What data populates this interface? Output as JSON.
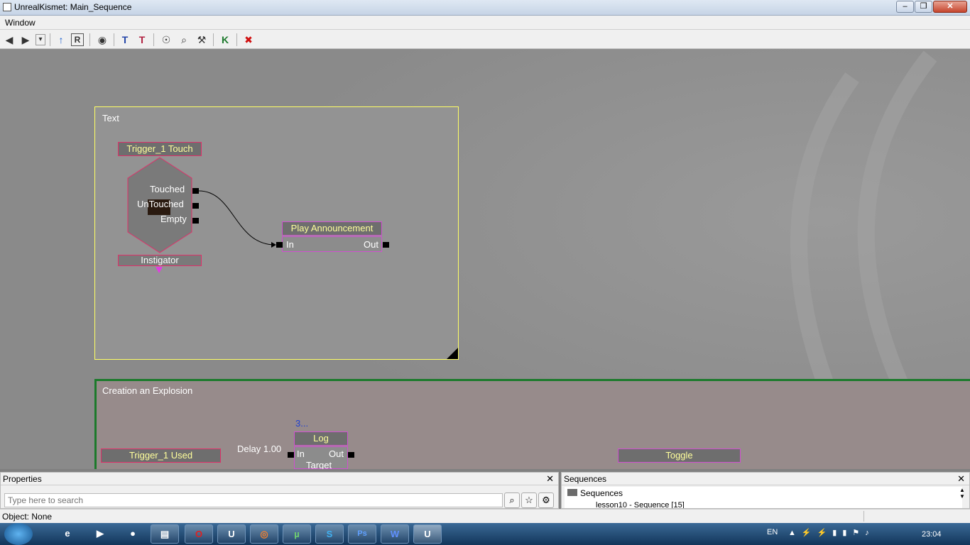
{
  "window": {
    "title": "UnrealKismet: Main_Sequence",
    "minimize": "–",
    "maximize": "❒",
    "close": "✕"
  },
  "menu": {
    "items": [
      "Window"
    ]
  },
  "toolbar": {
    "icons": [
      "back-arrow-icon",
      "forward-arrow-icon",
      "history-dropdown-icon",
      "parent-sequence-icon",
      "rename-icon",
      "hide-unused-icon",
      "zoom-to-fit-icon",
      "zoom-to-selection-icon",
      "light-bulb-icon",
      "search-icon",
      "wrench-icon",
      "kismet-icon",
      "stop-icon"
    ],
    "glyphs": [
      "◀",
      "▶",
      "▾",
      "↑",
      "R",
      "◉",
      "T",
      "T",
      "☉",
      "⌕",
      "⚒",
      "K",
      "✖"
    ]
  },
  "canvas": {
    "comment_text": {
      "title": "Text"
    },
    "comment_explosion": {
      "title": "Creation an Explosion"
    },
    "trigger_touch": {
      "title": "Trigger_1 Touch",
      "out_touched": "Touched",
      "out_untouched": "UnTouched",
      "out_empty": "Empty",
      "var": "Instigator"
    },
    "play_announcement": {
      "title": "Play Announcement",
      "in": "In",
      "out": "Out"
    },
    "trigger_used": {
      "title": "Trigger_1 Used"
    },
    "delay_label": "Delay 1.00",
    "log": {
      "title": "Log",
      "in": "In",
      "out": "Out",
      "target": "Target",
      "above": "3..."
    },
    "toggle": {
      "title": "Toggle"
    }
  },
  "properties": {
    "title": "Properties",
    "search_placeholder": "Type here to search"
  },
  "sequences": {
    "title": "Sequences",
    "root": "Sequences",
    "child": "lesson10 - Sequence [15]"
  },
  "status": {
    "text": "Object: None"
  },
  "taskbar": {
    "apps": [
      "ie-icon",
      "media-player-icon",
      "game-icon",
      "explorer-icon",
      "opera-icon",
      "unreal-icon",
      "firefox-icon",
      "utorrent-icon",
      "skype-icon",
      "photoshop-icon",
      "word-icon",
      "unreal-kismet-icon"
    ],
    "glyphs": [
      "e",
      "▶",
      "●",
      "▤",
      "O",
      "U",
      "◎",
      "µ",
      "S",
      "Ps",
      "W",
      "U"
    ],
    "lang": "EN",
    "clock": "23:04"
  }
}
